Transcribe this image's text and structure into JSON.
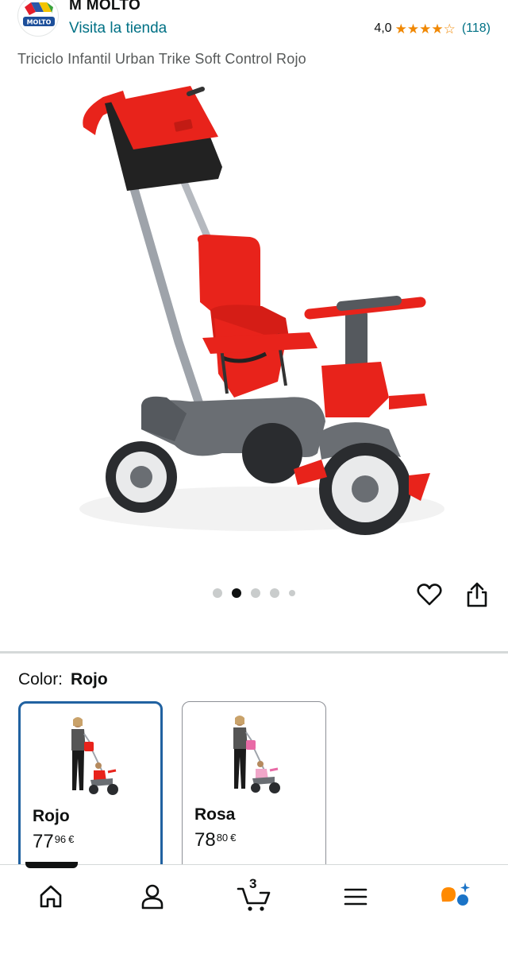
{
  "header": {
    "brand_name": "M MOLTO",
    "logo_text": "MOLTO",
    "store_link": "Visita la tienda",
    "rating_value": "4,0",
    "rating_count": "(118)",
    "stars_filled": 4,
    "stars_total": 5
  },
  "product": {
    "title": "Triciclo Infantil Urban Trike Soft Control Rojo"
  },
  "gallery": {
    "image_count": 5,
    "active_index": 2
  },
  "variation": {
    "label": "Color:",
    "selected": "Rojo",
    "options": [
      {
        "name": "Rojo",
        "price_whole": "77",
        "price_fraction": "96",
        "currency": "€"
      },
      {
        "name": "Rosa",
        "price_whole": "78",
        "price_fraction": "80",
        "currency": "€"
      }
    ]
  },
  "navbar": {
    "cart_count": "3"
  },
  "colors": {
    "link": "#007185",
    "star": "#f08804",
    "selected_border": "#2162a1",
    "product_red": "#e8231b"
  }
}
